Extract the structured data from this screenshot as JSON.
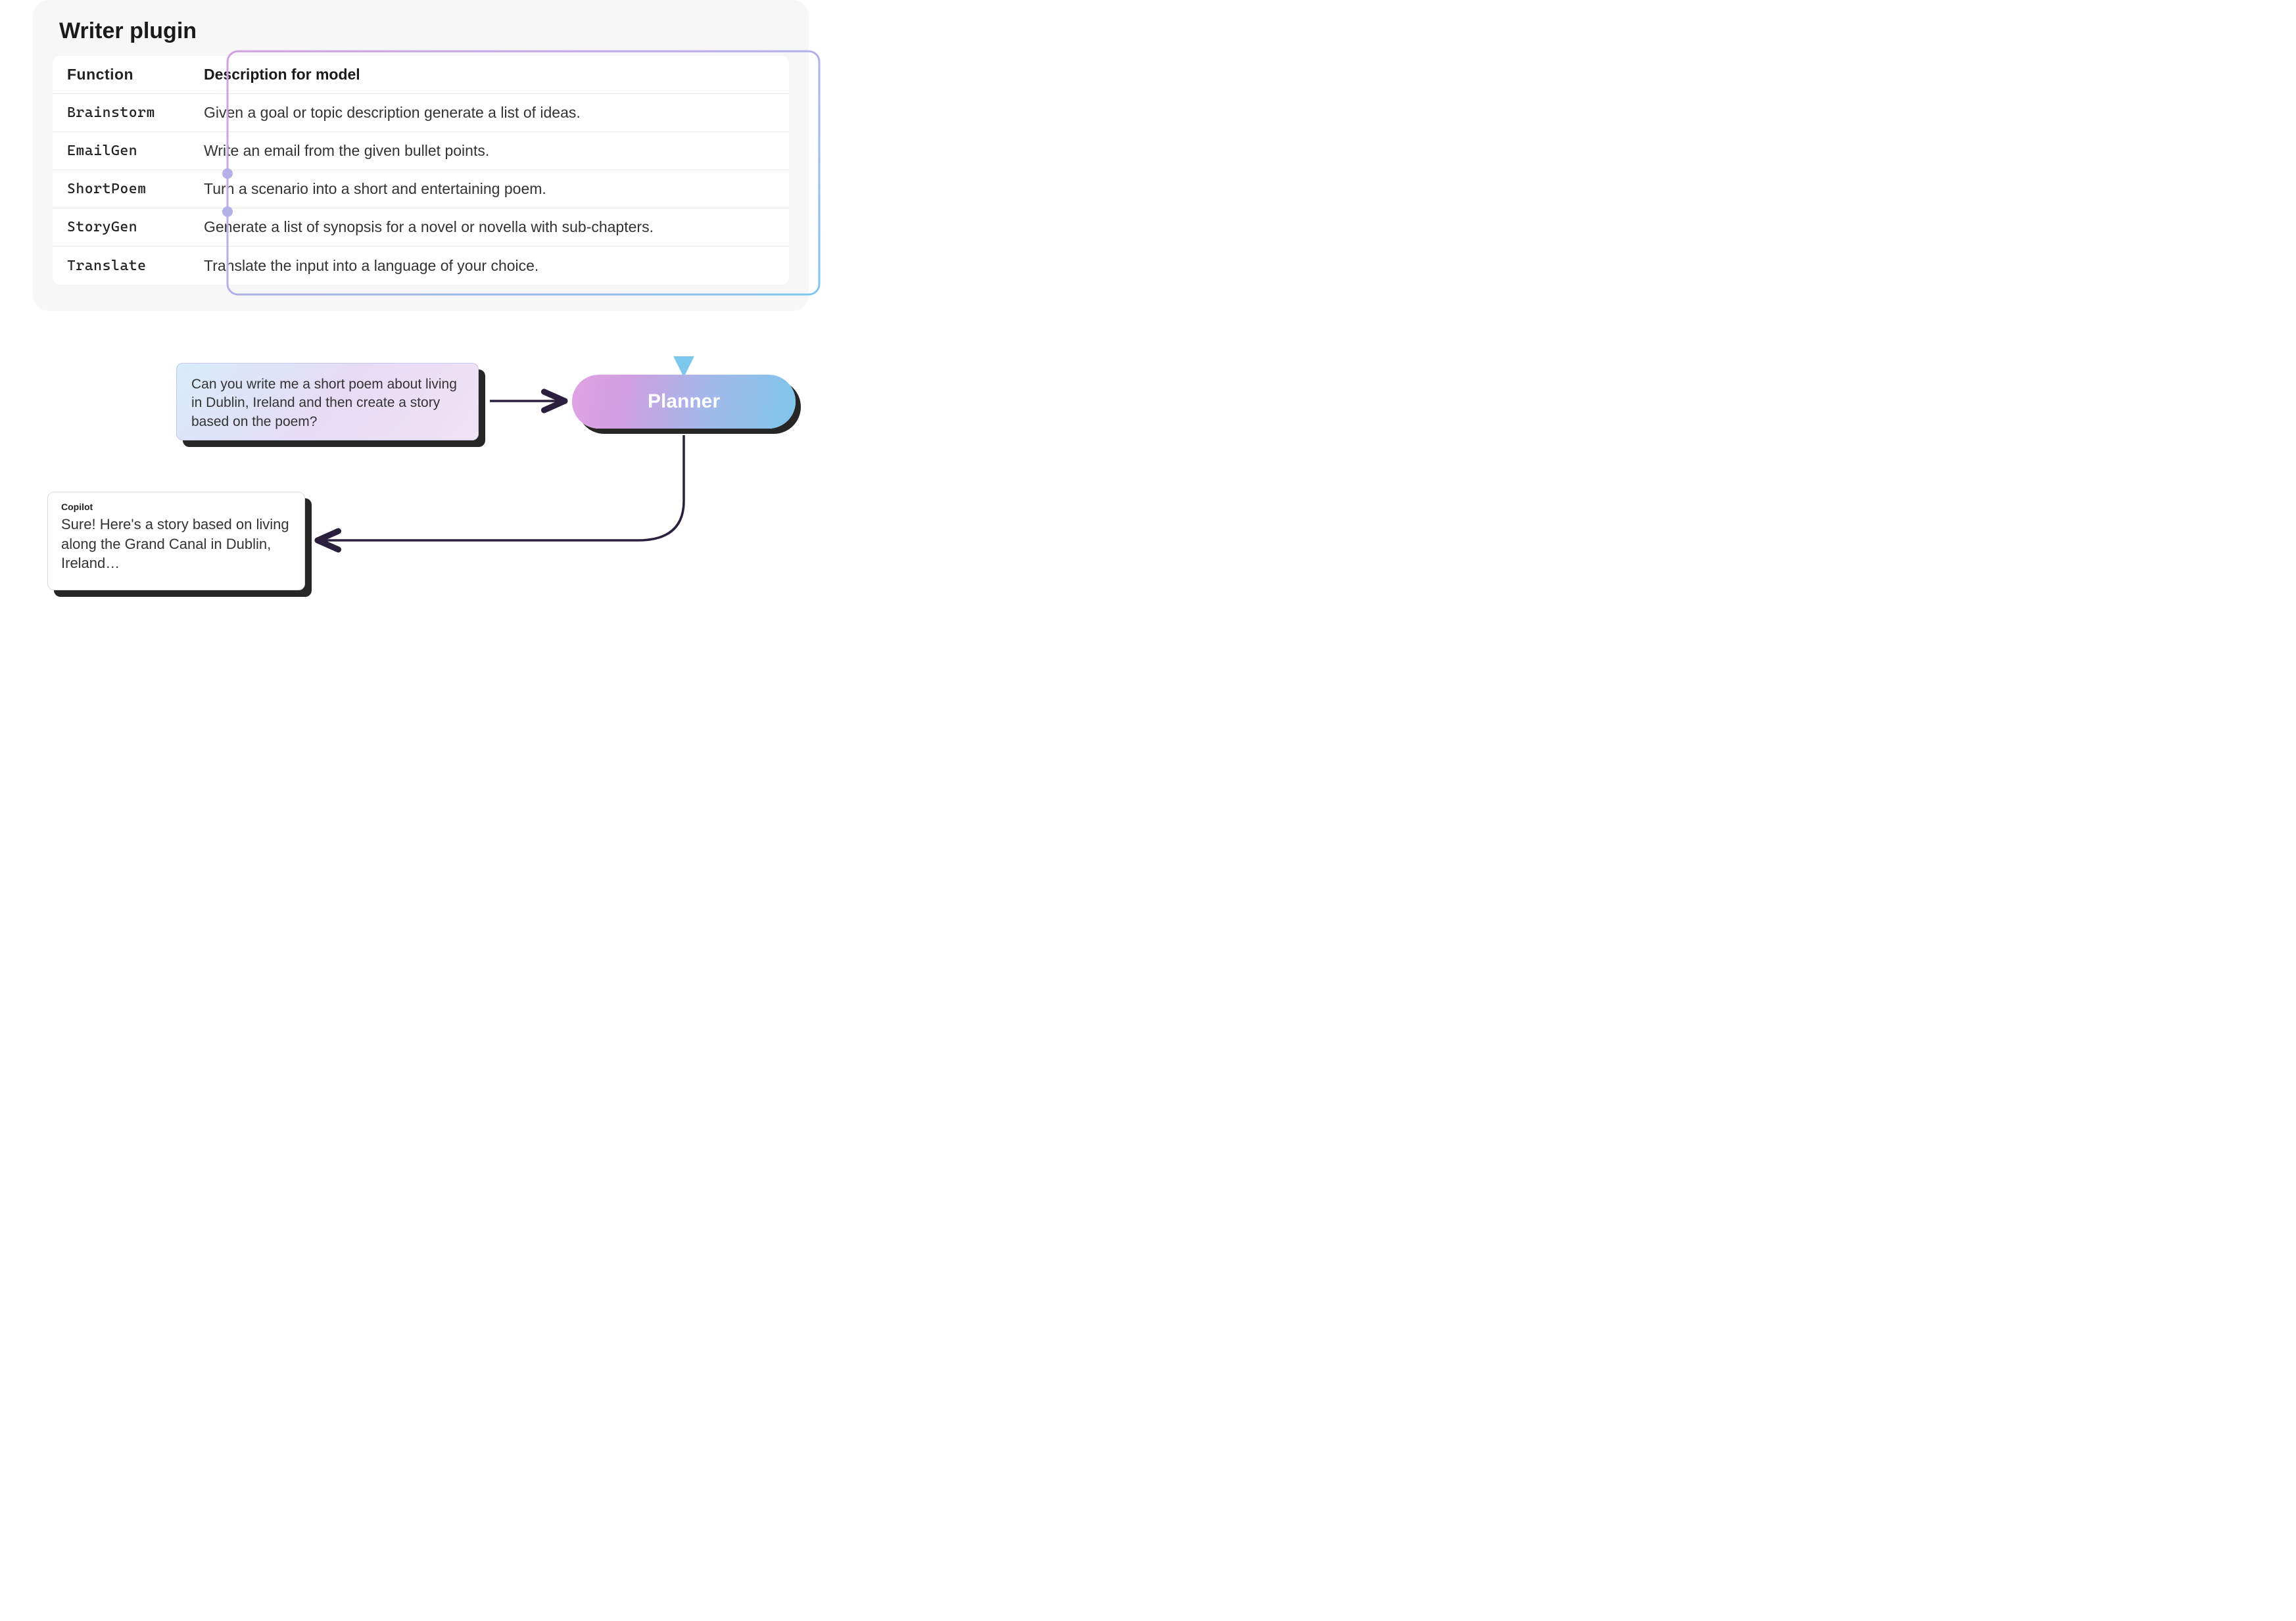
{
  "plugin": {
    "title": "Writer plugin",
    "headers": {
      "function": "Function",
      "description": "Description for model"
    },
    "rows": [
      {
        "name": "Brainstorm",
        "desc": "Given a goal or topic description generate a list of ideas."
      },
      {
        "name": "EmailGen",
        "desc": "Write an email from the given bullet points."
      },
      {
        "name": "ShortPoem",
        "desc": "Turn a scenario into a short and entertaining poem."
      },
      {
        "name": "StoryGen",
        "desc": "Generate a list of synopsis for a novel or novella with sub-chapters."
      },
      {
        "name": "Translate",
        "desc": "Translate the input into a language of your choice."
      }
    ]
  },
  "prompt": {
    "text": "Can you write me a short poem about living in Dublin, Ireland and then create a story based on the poem?"
  },
  "planner": {
    "label": "Planner"
  },
  "response": {
    "label": "Copilot",
    "text": "Sure! Here's a story based on living along the Grand Canal in Dublin, Ireland…"
  }
}
